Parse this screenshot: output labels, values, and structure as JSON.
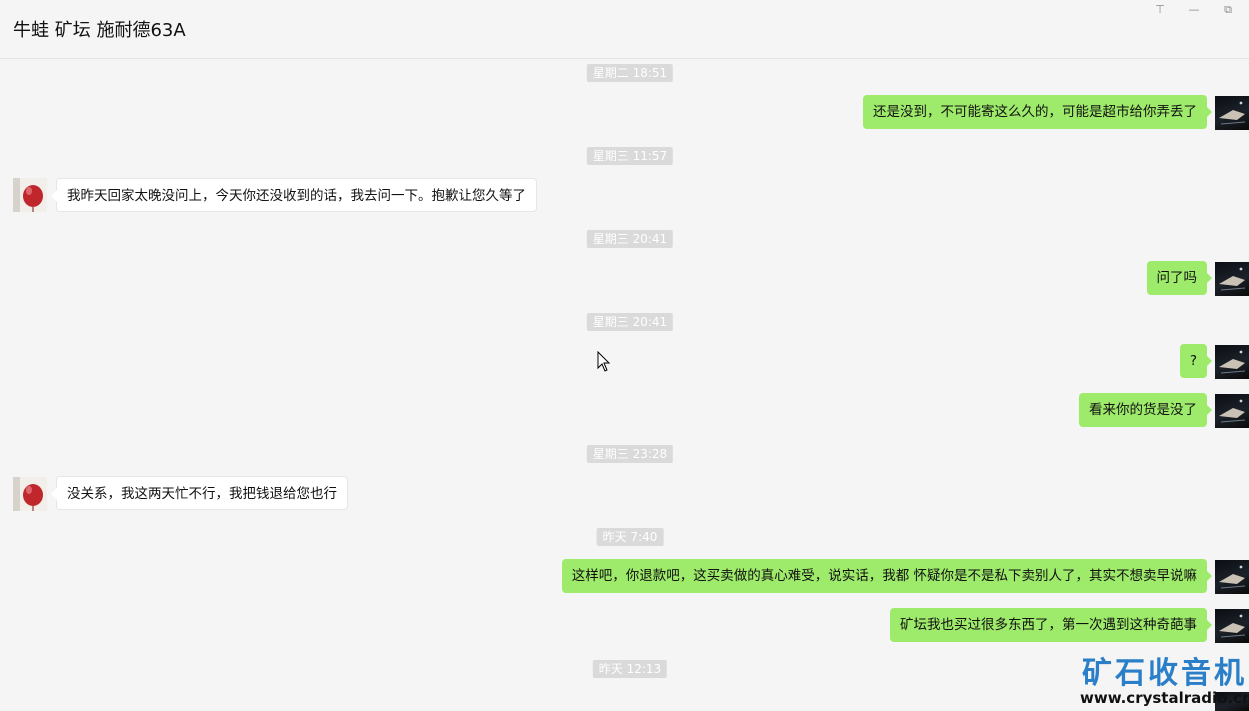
{
  "header": {
    "title": "牛蛙 矿坛 施耐德63A"
  },
  "window_controls": {
    "pin": "⊤",
    "minimize": "—",
    "restore": "⧉"
  },
  "messages": [
    {
      "kind": "time",
      "text": "星期二 18:51"
    },
    {
      "kind": "msg",
      "from": "me",
      "text": "还是没到，不可能寄这么久的，可能是超市给你弄丢了"
    },
    {
      "kind": "time",
      "text": "星期三 11:57"
    },
    {
      "kind": "msg",
      "from": "other",
      "text": "我昨天回家太晚没问上，今天你还没收到的话，我去问一下。抱歉让您久等了"
    },
    {
      "kind": "time",
      "text": "星期三 20:41"
    },
    {
      "kind": "msg",
      "from": "me",
      "text": "问了吗"
    },
    {
      "kind": "time",
      "text": "星期三 20:41"
    },
    {
      "kind": "msg",
      "from": "me",
      "text": "?"
    },
    {
      "kind": "msg",
      "from": "me",
      "text": "看来你的货是没了"
    },
    {
      "kind": "time",
      "text": "星期三 23:28"
    },
    {
      "kind": "msg",
      "from": "other",
      "text": "没关系，我这两天忙不行，我把钱退给您也行"
    },
    {
      "kind": "time",
      "text": "昨天 7:40"
    },
    {
      "kind": "msg",
      "from": "me",
      "text": "这样吧，你退款吧，这买卖做的真心难受，说实话，我都 怀疑你是不是私下卖别人了，其实不想卖早说嘛"
    },
    {
      "kind": "msg",
      "from": "me",
      "text": "矿坛我也买过很多东西了，第一次遇到这种奇葩事"
    },
    {
      "kind": "time",
      "text": "昨天 12:13"
    }
  ],
  "watermark": {
    "title": "矿石收音机",
    "url": "www.crystalradio.cn"
  },
  "colors": {
    "my_bubble": "#9eea6a",
    "other_bubble": "#ffffff",
    "background": "#f5f5f5",
    "time_pill": "#dadada",
    "watermark": "#2a7fc8"
  }
}
